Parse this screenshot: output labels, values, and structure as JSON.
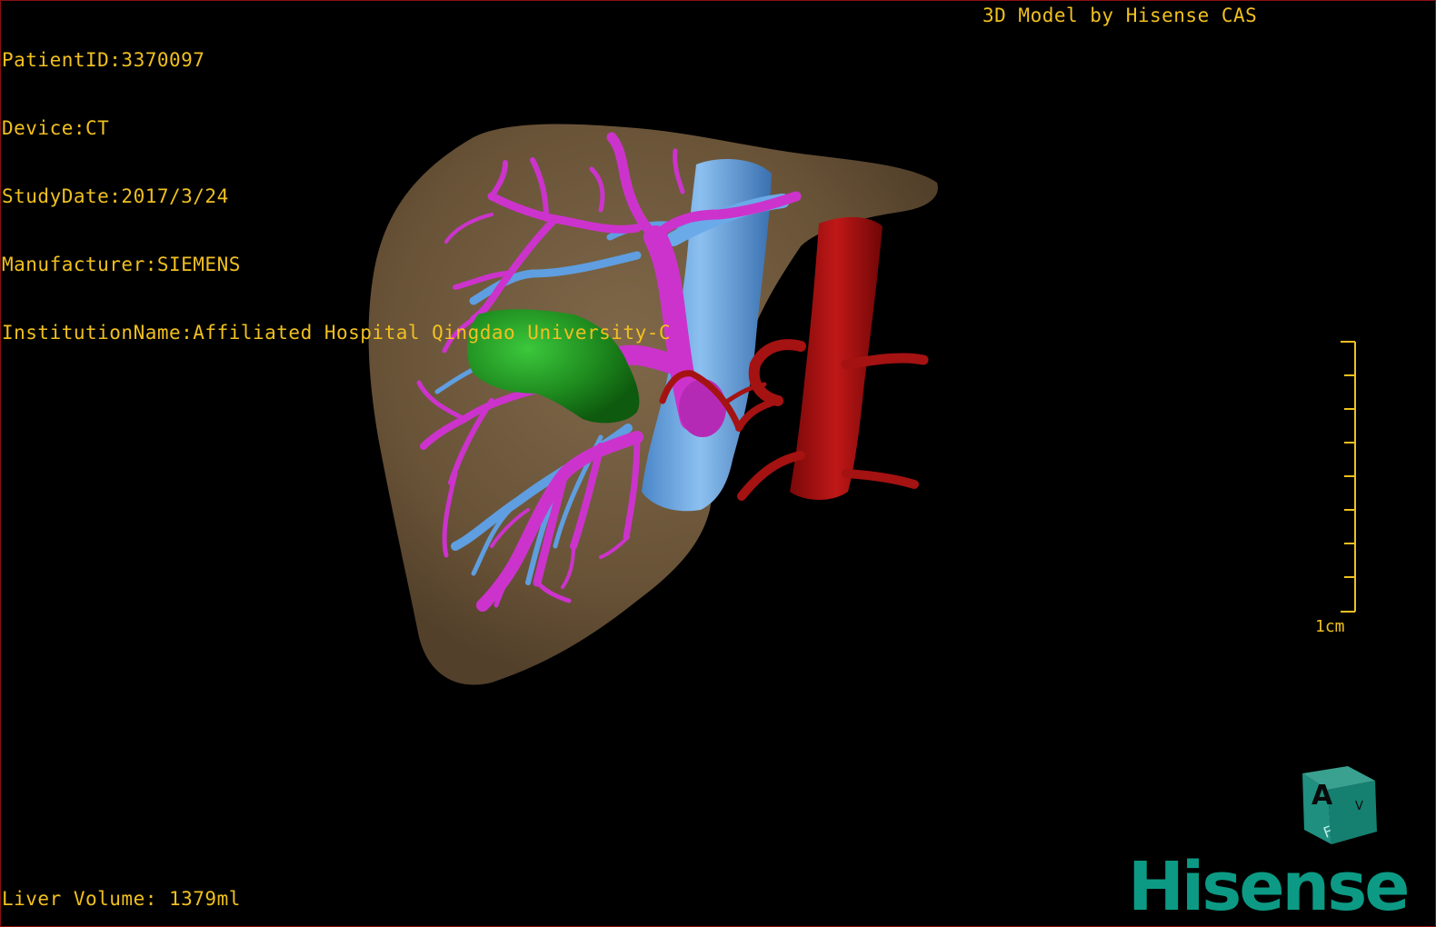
{
  "dicom": {
    "patient_id": "PatientID:3370097",
    "device": "Device:CT",
    "study_date": "StudyDate:2017/3/24",
    "manufacturer": "Manufacturer:SIEMENS",
    "institution": "InstitutionName:Affiliated Hospital Qingdao University-C"
  },
  "watermark_title": "3D Model by Hisense CAS",
  "liver_volume": "Liver Volume: 1379ml",
  "scale": {
    "label": "1cm"
  },
  "orientation_cube": {
    "front_label": "A",
    "bottom_label": "F",
    "side_label": "V"
  },
  "brand": "Hisense",
  "colors": {
    "overlay_text": "#f0c020",
    "liver": "#7a6242",
    "portal_vein": "#cc33cc",
    "hepatic_vein": "#5f9ee0",
    "tumor": "#1e8a1e",
    "artery": "#a01010",
    "brand": "#0c9a85"
  }
}
